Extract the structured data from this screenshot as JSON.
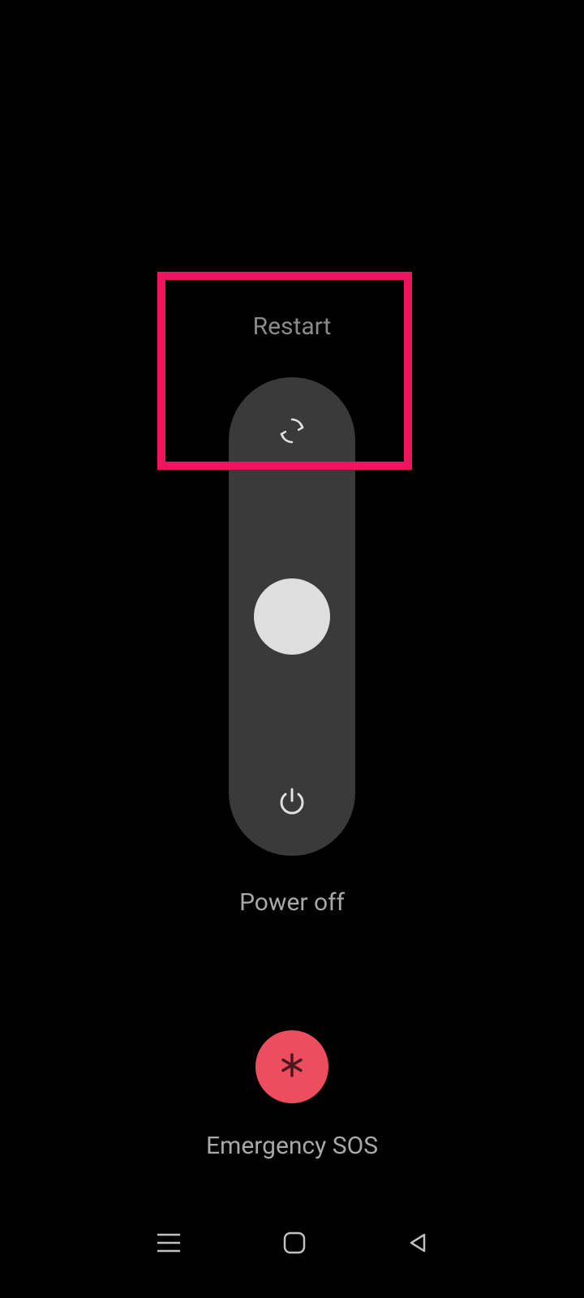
{
  "power_menu": {
    "restart_label": "Restart",
    "poweroff_label": "Power off"
  },
  "sos": {
    "label": "Emergency SOS"
  },
  "colors": {
    "sos_button": "#ed4e5f",
    "highlight": "#ec1560",
    "capsule": "#3a3a3a",
    "handle": "#dedede"
  }
}
